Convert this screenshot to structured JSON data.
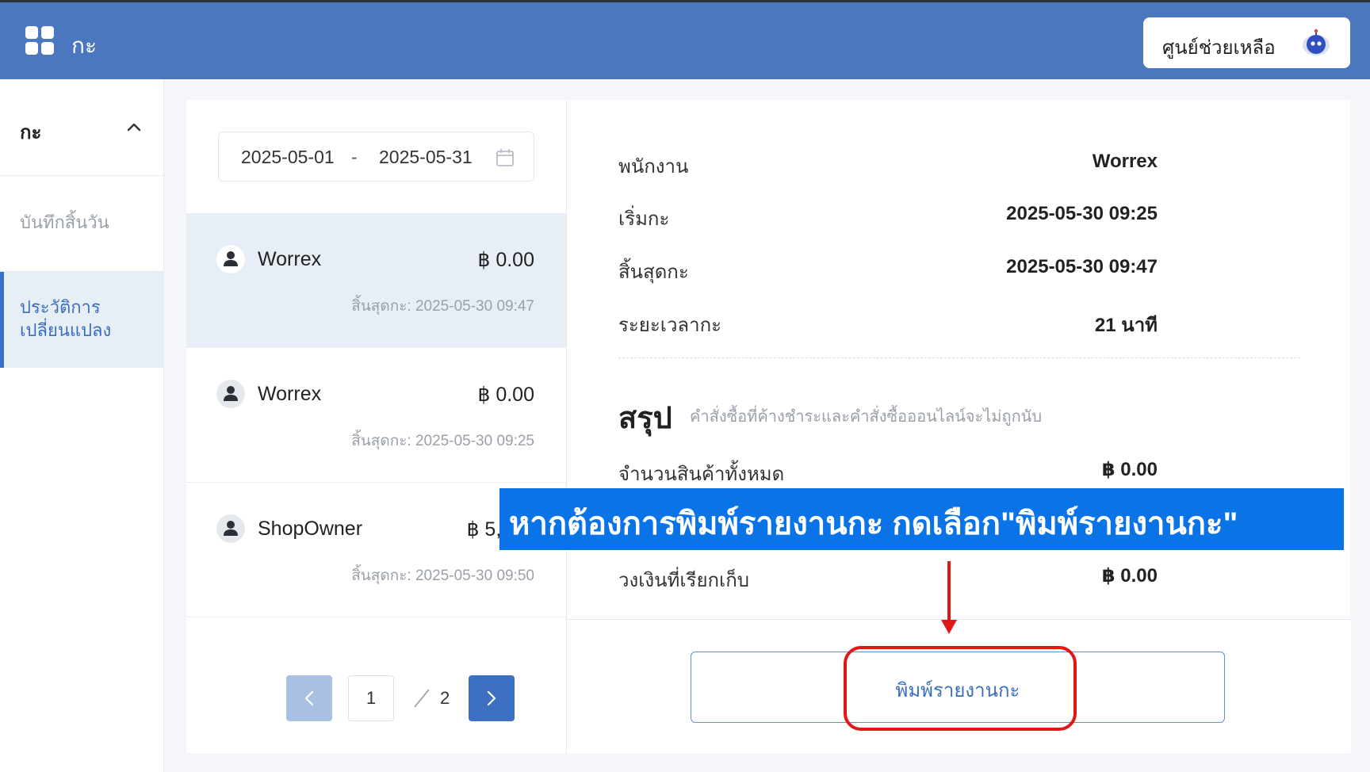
{
  "header": {
    "title": "กะ",
    "help_label": "ศูนย์ช่วยเหลือ",
    "colors": {
      "bar": "#4a77be",
      "accent": "#3a6fc0"
    }
  },
  "sidebar": {
    "section_label": "กะ",
    "items": [
      {
        "label": "บันทึกสิ้นวัน",
        "active": false
      },
      {
        "label": "ประวัติการเปลี่ยนแปลง",
        "active": true
      }
    ]
  },
  "list": {
    "date_start": "2025-05-01",
    "date_sep": "-",
    "date_end": "2025-05-31",
    "shifts": [
      {
        "name": "Worrex",
        "amount": "฿ 0.00",
        "end": "สิ้นสุดกะ: 2025-05-30 09:47",
        "active": true
      },
      {
        "name": "Worrex",
        "amount": "฿ 0.00",
        "end": "สิ้นสุดกะ: 2025-05-30 09:25",
        "active": false
      },
      {
        "name": "ShopOwner",
        "amount": "฿ 5,000",
        "end": "สิ้นสุดกะ: 2025-05-30 09:50",
        "active": false
      }
    ],
    "pager": {
      "current": "1",
      "total": "2"
    }
  },
  "detail": {
    "rows": [
      {
        "label": "พนักงาน",
        "value": "Worrex"
      },
      {
        "label": "เริ่มกะ",
        "value": "2025-05-30 09:25"
      },
      {
        "label": "สิ้นสุดกะ",
        "value": "2025-05-30 09:47"
      },
      {
        "label": "ระยะเวลากะ",
        "value": "21 นาที"
      }
    ],
    "summary_title": "สรุป",
    "summary_note": "คำสั่งซื้อที่ค้างชำระและคำสั่งซื้อออนไลน์จะไม่ถูกนับ",
    "summary_rows": [
      {
        "label": "จำนวนสินค้าทั้งหมด",
        "value": "฿ 0.00"
      },
      {
        "label": "วงเงินที่เรียกเก็บ",
        "value": "฿ 0.00"
      }
    ],
    "print_label": "พิมพ์รายงานกะ"
  },
  "overlay": {
    "banner_text": "หากต้องการพิมพ์รายงานกะ กดเลือก\"พิมพ์รายงานกะ\"",
    "banner_color": "#0a73e6",
    "highlight_color": "#e01818"
  }
}
